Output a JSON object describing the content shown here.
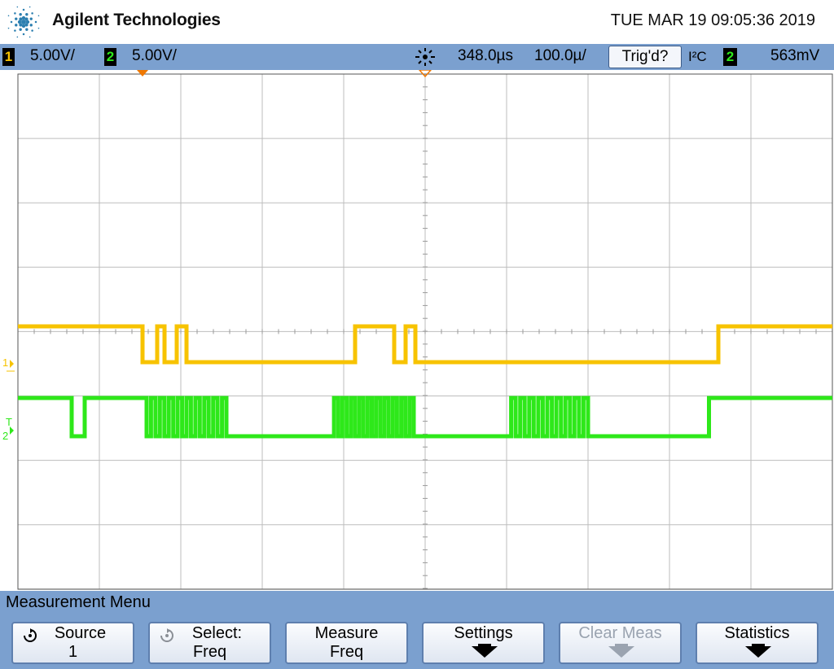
{
  "header": {
    "brand": "Agilent Technologies",
    "datetime": "TUE MAR 19 09:05:36 2019",
    "logo_icon": "agilent-spark-icon"
  },
  "status": {
    "ch1_badge": "1",
    "ch1_scale": "5.00V/",
    "ch2_badge": "2",
    "ch2_scale": "5.00V/",
    "delay": "348.0µs",
    "timebase": "100.0µ/",
    "trigger_status": "Trig'd?",
    "trigger_mode": "I²C",
    "trigger_source_badge": "2",
    "trigger_level": "563mV"
  },
  "markers": {
    "ch1_ground": "1",
    "ch2_ground": "2",
    "trigger": "T"
  },
  "colors": {
    "ch1": "#f7c300",
    "ch2": "#2ee81a",
    "grid": "#bdbdbd",
    "bar": "#7ba0cf",
    "marker_orange": "#f07800"
  },
  "menu": {
    "title": "Measurement Menu",
    "softkeys": [
      {
        "line1": "Source",
        "line2": "1",
        "icon": "rotate-knob-icon",
        "enabled": true
      },
      {
        "line1": "Select:",
        "line2": "Freq",
        "icon": "rotate-knob-icon",
        "enabled": true
      },
      {
        "line1": "Measure",
        "line2": "Freq",
        "enabled": true
      },
      {
        "line1": "Settings",
        "icon": "arrow-down-icon",
        "enabled": true
      },
      {
        "line1": "Clear Meas",
        "icon": "arrow-down-icon",
        "enabled": false
      },
      {
        "line1": "Statistics",
        "icon": "arrow-down-icon",
        "enabled": true
      }
    ]
  }
}
